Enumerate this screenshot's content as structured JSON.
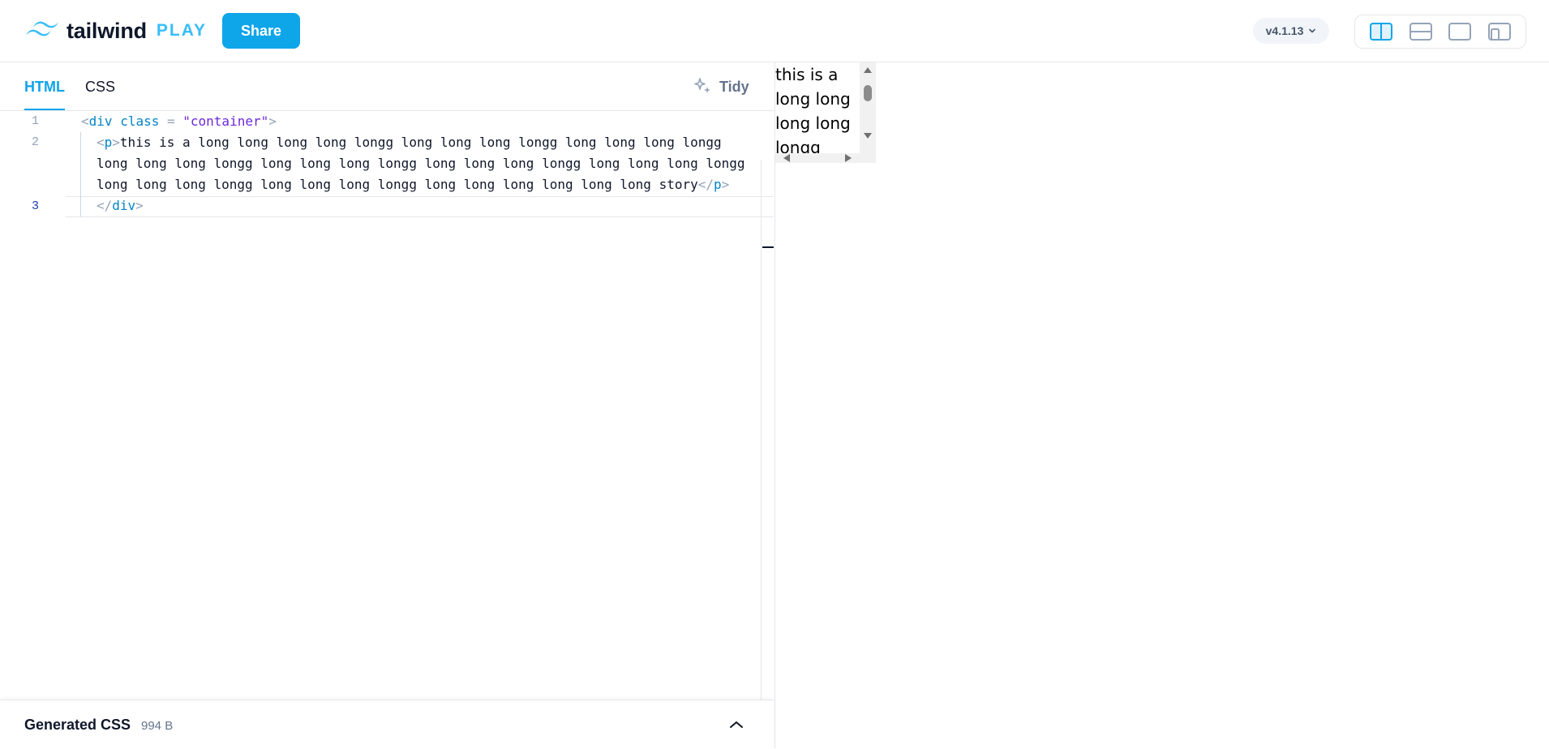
{
  "header": {
    "logo_text": "tailwind",
    "logo_play": "PLAY",
    "share_label": "Share",
    "version": "v4.1.13",
    "layout_buttons": [
      "layout-split-vertical",
      "layout-split-horizontal",
      "layout-preview-only",
      "layout-responsive"
    ]
  },
  "editor": {
    "tabs": [
      {
        "label": "HTML",
        "active": true
      },
      {
        "label": "CSS",
        "active": false
      }
    ],
    "tidy_label": "Tidy",
    "line_numbers": [
      "1",
      "2",
      "3"
    ],
    "code": {
      "line1": {
        "open": "<",
        "tag": "div",
        "attr": "class",
        "eq": " = ",
        "value": "\"container\"",
        "close": ">"
      },
      "line2a_open": "<",
      "line2a_tag": "p",
      "line2a_gt": ">",
      "line2a_text": "this is a long long long long longg long long long longg long long long longg",
      "line2b_text": "long long long longg long long long longg long long long longg long long long longg",
      "line2c_text": "long long long longg long long long longg long long long long long long story",
      "line2c_close_open": "</",
      "line2c_close_tag": "p",
      "line2c_close_gt": ">",
      "line3_open": "</",
      "line3_tag": "div",
      "line3_gt": ">"
    },
    "generated_css": {
      "label": "Generated CSS",
      "size": "994 B"
    }
  },
  "preview": {
    "text_lines": [
      "this is a",
      "long long",
      "long long",
      "longg long"
    ]
  },
  "colors": {
    "accent": "#0ea5e9",
    "logo_play": "#38bdf8",
    "tag": "#0284c7",
    "string": "#6d28d9"
  }
}
